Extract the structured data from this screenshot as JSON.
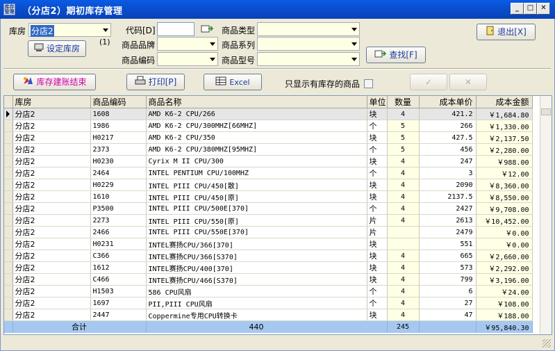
{
  "window": {
    "icon_text": "库存\n管理",
    "title": "（分店2）期初库存管理"
  },
  "filters": {
    "warehouse_label": "库房",
    "warehouse_value": "分店2",
    "set_warehouse_button": "设定库房",
    "count_hint": "(1)",
    "code_label": "代码[D]",
    "code_value": "",
    "brand_label": "商品品牌",
    "product_code_label": "商品编码",
    "type_label": "商品类型",
    "series_label": "商品系列",
    "model_label": "商品型号",
    "exit_button": "退出[X]",
    "search_button": "查找[F]"
  },
  "toolbar": {
    "close_account_button": "库存建账结束",
    "print_button": "打印[P]",
    "excel_button": "Excel",
    "only_stock_label": "只显示有库存的商品",
    "only_stock_checked": false
  },
  "grid": {
    "columns": [
      "库房",
      "商品编码",
      "商品名称",
      "单位",
      "数量",
      "成本单价",
      "成本金额"
    ],
    "rows": [
      [
        "分店2",
        "1608",
        "AMD K6-2 CPU/266",
        "块",
        "4",
        "421.2",
        "￥1,684.80"
      ],
      [
        "分店2",
        "1986",
        "AMD K6-2 CPU/300MHZ[66MHZ]",
        "个",
        "5",
        "266",
        "￥1,330.00"
      ],
      [
        "分店2",
        "H0217",
        "AMD K6-2 CPU/350",
        "块",
        "5",
        "427.5",
        "￥2,137.50"
      ],
      [
        "分店2",
        "2373",
        "AMD K6-2 CPU/380MHZ[95MHZ]",
        "个",
        "5",
        "456",
        "￥2,280.00"
      ],
      [
        "分店2",
        "H0230",
        "Cyrix M II CPU/300",
        "块",
        "4",
        "247",
        "￥988.00"
      ],
      [
        "分店2",
        "2464",
        "INTEL PENTIUM CPU/100MHZ",
        "个",
        "4",
        "3",
        "￥12.00"
      ],
      [
        "分店2",
        "H0229",
        "INTEL PIII CPU/450[散]",
        "块",
        "4",
        "2090",
        "￥8,360.00"
      ],
      [
        "分店2",
        "1610",
        "INTEL PIII CPU/450[原]",
        "块",
        "4",
        "2137.5",
        "￥8,550.00"
      ],
      [
        "分店2",
        "P3500",
        "INTEL PIII CPU/500E[370]",
        "个",
        "4",
        "2427",
        "￥9,708.00"
      ],
      [
        "分店2",
        "2273",
        "INTEL PIII CPU/550[原]",
        "片",
        "4",
        "2613",
        "￥10,452.00"
      ],
      [
        "分店2",
        "2466",
        "INTEL PIII CPU/550E[370]",
        "片",
        "",
        "2479",
        "￥0.00"
      ],
      [
        "分店2",
        "H0231",
        "INTEL赛扬CPU/366[370]",
        "块",
        "",
        "551",
        "￥0.00"
      ],
      [
        "分店2",
        "C366",
        "INTEL赛扬CPU/366[S370]",
        "块",
        "4",
        "665",
        "￥2,660.00"
      ],
      [
        "分店2",
        "1612",
        "INTEL赛扬CPU/400[370]",
        "块",
        "4",
        "573",
        "￥2,292.00"
      ],
      [
        "分店2",
        "C466",
        "INTEL赛扬CPU/466[S370]",
        "块",
        "4",
        "799",
        "￥3,196.00"
      ],
      [
        "分店2",
        "H1503",
        "586 CPU风扇",
        "个",
        "4",
        "6",
        "￥24.00"
      ],
      [
        "分店2",
        "1697",
        "PII,PIII CPU风扇",
        "个",
        "4",
        "27",
        "￥108.00"
      ],
      [
        "分店2",
        "2447",
        "Coppermine专用CPU转换卡",
        "块",
        "4",
        "47",
        "￥188.00"
      ]
    ],
    "total": {
      "label": "合计",
      "code_count": "440",
      "quantity": "245",
      "amount": "￥95,840.30"
    }
  },
  "colors": {
    "titlebar": "#0a4fd0",
    "cell_yellow": "#ffffe6",
    "total_row": "#a6c8f0"
  }
}
